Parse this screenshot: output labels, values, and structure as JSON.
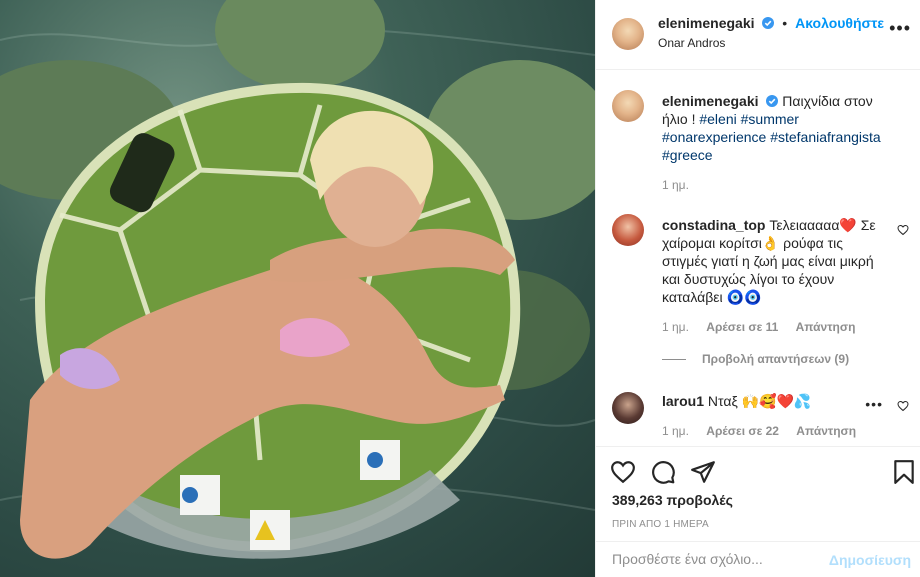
{
  "post": {
    "username": "elenimenegaki",
    "follow_label": "Ακολουθήστε",
    "dot": "•",
    "location": "Onar Andros",
    "more": "•••"
  },
  "caption": {
    "username": "elenimenegaki",
    "text": "Παιχνίδια στον ήλιο !",
    "hashtags": [
      "#eleni",
      "#summer",
      "#onarexperience",
      "#stefaniafrangista",
      "#greece"
    ],
    "age": "1 ημ."
  },
  "comments": [
    {
      "username": "constadina_top",
      "text": "Τελειααααα❤️ Σε χαίρομαι κορίτσι👌 ρούφα τις στιγμές γιατί η ζωή μας είναι μικρή και δυστυχώς λίγοι το έχουν καταλάβει 🧿🧿",
      "age": "1 ημ.",
      "likes": "Αρέσει σε 11",
      "reply": "Απάντηση"
    },
    {
      "username": "larou1",
      "text": "Νταξ 🙌🥰❤️💦",
      "age": "1 ημ.",
      "likes": "Αρέσει σε 22",
      "reply": "Απάντηση"
    }
  ],
  "view_replies": "Προβολή απαντήσεων (9)",
  "views": "389,263 προβολές",
  "timestamp": "ΠΡΙΝ ΑΠΟ 1 ΗΜΕΡΑ",
  "add_comment": {
    "placeholder": "Προσθέστε ένα σχόλιο...",
    "post_label": "Δημοσίευση"
  },
  "colors": {
    "accent": "#0095f6",
    "hashtag": "#00376b",
    "muted": "#8e8e8e",
    "verified": "#3897f0",
    "heart": "#ed4956"
  },
  "icons": [
    "heart-icon",
    "comment-icon",
    "share-icon",
    "bookmark-icon",
    "verified-icon",
    "more-icon"
  ]
}
